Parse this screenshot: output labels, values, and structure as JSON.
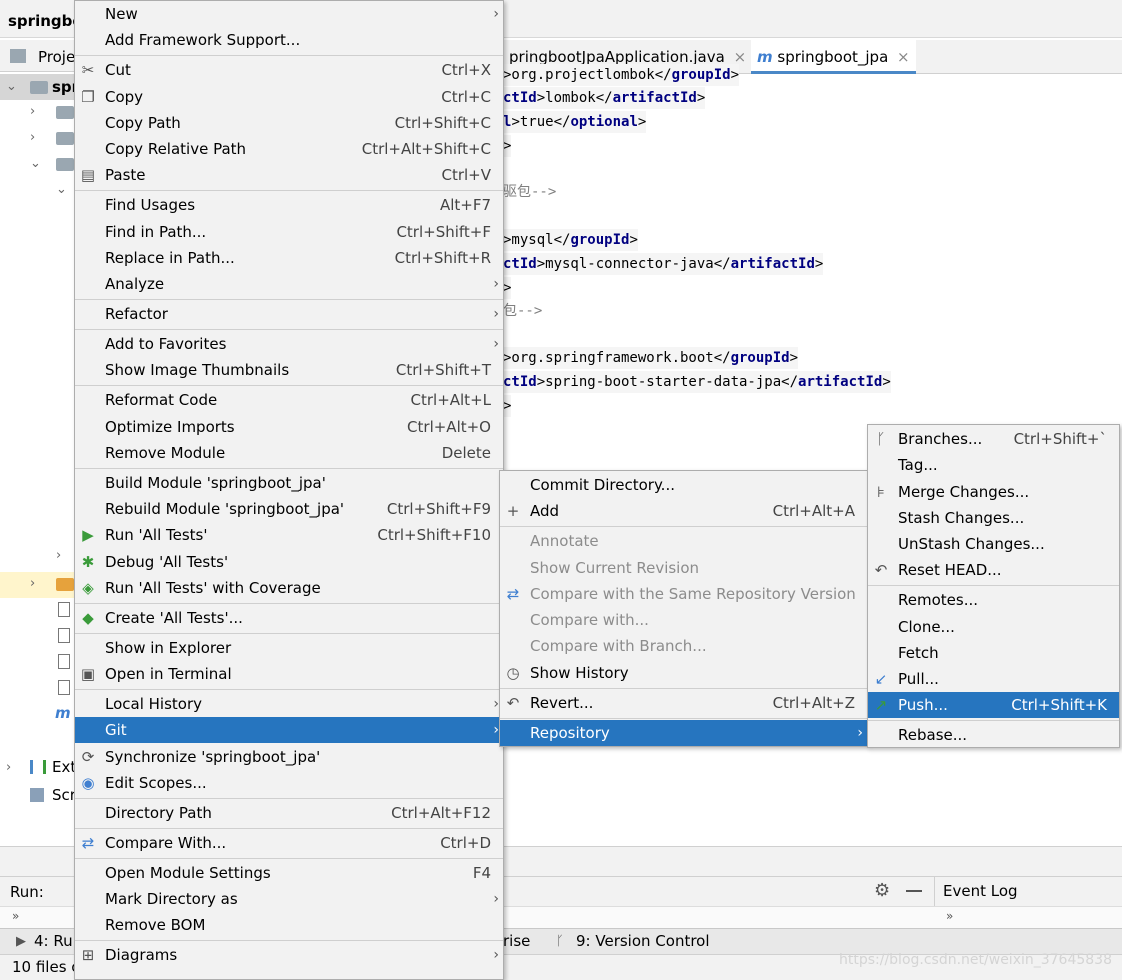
{
  "ide": {
    "project_name": "springbo",
    "project_tab": "Proje",
    "project_root": "spr",
    "editor_tabs": [
      {
        "label": "pringbootJpaApplication.java",
        "active": false,
        "icon": "java-icon"
      },
      {
        "label": "springboot_jpa",
        "active": true,
        "icon": "maven-icon"
      }
    ],
    "tab_close": "×",
    "tree_items": {
      "external_libraries": "Ext",
      "scratches": "Scr"
    },
    "code_lines": [
      {
        "pre": "",
        "tag": "",
        "text": ">org.projectlombok</",
        "tag2": "groupId",
        "post": ">"
      },
      {
        "pre": "",
        "tag": "ctId",
        "text": ">lombok</",
        "tag2": "artifactId",
        "post": ">"
      },
      {
        "pre": "",
        "tag": "l",
        "text": ">true</",
        "tag2": "optional",
        "post": ">"
      },
      {
        "pre": "",
        "tag": "",
        "text": ">",
        "tag2": "",
        "post": ""
      },
      {
        "pre": "",
        "tag": "",
        "text": "",
        "tag2": "",
        "post": ""
      },
      {
        "comment": "驱包-->"
      },
      {
        "pre": "",
        "tag": "",
        "text": "",
        "tag2": "",
        "post": ""
      },
      {
        "pre": "",
        "tag": "",
        "text": ">mysql</",
        "tag2": "groupId",
        "post": ">"
      },
      {
        "pre": "",
        "tag": "ctId",
        "text": ">mysql-connector-java</",
        "tag2": "artifactId",
        "post": ">"
      },
      {
        "pre": "",
        "tag": "",
        "text": ">",
        "tag2": "",
        "post": ""
      },
      {
        "comment": "包-->"
      },
      {
        "pre": "",
        "tag": "",
        "text": "",
        "tag2": "",
        "post": ""
      },
      {
        "pre": "",
        "tag": "",
        "text": ">org.springframework.boot</",
        "tag2": "groupId",
        "post": ">"
      },
      {
        "pre": "",
        "tag": "ctId",
        "text": ">spring-boot-starter-data-jpa</",
        "tag2": "artifactId",
        "post": ">"
      },
      {
        "pre": "",
        "tag": "",
        "text": ">",
        "tag2": "",
        "post": ""
      }
    ],
    "run_label": "Run:",
    "event_log": "Event Log",
    "status_run": "4: Ru",
    "status_prise": "rise",
    "status_vc": "9: Version Control",
    "status_files": "10 files c",
    "watermark": "https://blog.csdn.net/weixin_37645838"
  },
  "main_menu": {
    "items": [
      {
        "label": "New",
        "shortcut": "",
        "submenu": true,
        "icon": ""
      },
      {
        "label": "Add Framework Support...",
        "shortcut": "",
        "submenu": false,
        "icon": ""
      },
      {
        "label": "Cut",
        "shortcut": "Ctrl+X",
        "submenu": false,
        "icon": "scissors-icon",
        "glyph": "✂"
      },
      {
        "label": "Copy",
        "shortcut": "Ctrl+C",
        "submenu": false,
        "icon": "copy-icon",
        "glyph": "❐"
      },
      {
        "label": "Copy Path",
        "shortcut": "Ctrl+Shift+C",
        "submenu": false,
        "icon": ""
      },
      {
        "label": "Copy Relative Path",
        "shortcut": "Ctrl+Alt+Shift+C",
        "submenu": false,
        "icon": ""
      },
      {
        "label": "Paste",
        "shortcut": "Ctrl+V",
        "submenu": false,
        "icon": "paste-icon",
        "glyph": "▤"
      },
      {
        "label": "Find Usages",
        "shortcut": "Alt+F7",
        "submenu": false,
        "icon": ""
      },
      {
        "label": "Find in Path...",
        "shortcut": "Ctrl+Shift+F",
        "submenu": false,
        "icon": ""
      },
      {
        "label": "Replace in Path...",
        "shortcut": "Ctrl+Shift+R",
        "submenu": false,
        "icon": ""
      },
      {
        "label": "Analyze",
        "shortcut": "",
        "submenu": true,
        "icon": ""
      },
      {
        "label": "Refactor",
        "shortcut": "",
        "submenu": true,
        "icon": ""
      },
      {
        "label": "Add to Favorites",
        "shortcut": "",
        "submenu": true,
        "icon": ""
      },
      {
        "label": "Show Image Thumbnails",
        "shortcut": "Ctrl+Shift+T",
        "submenu": false,
        "icon": ""
      },
      {
        "label": "Reformat Code",
        "shortcut": "Ctrl+Alt+L",
        "submenu": false,
        "icon": ""
      },
      {
        "label": "Optimize Imports",
        "shortcut": "Ctrl+Alt+O",
        "submenu": false,
        "icon": ""
      },
      {
        "label": "Remove Module",
        "shortcut": "Delete",
        "submenu": false,
        "icon": ""
      },
      {
        "label": "Build Module 'springboot_jpa'",
        "shortcut": "",
        "submenu": false,
        "icon": ""
      },
      {
        "label": "Rebuild Module 'springboot_jpa'",
        "shortcut": "Ctrl+Shift+F9",
        "submenu": false,
        "icon": ""
      },
      {
        "label": "Run 'All Tests'",
        "shortcut": "Ctrl+Shift+F10",
        "submenu": false,
        "icon": "run-icon",
        "glyph": "▶"
      },
      {
        "label": "Debug 'All Tests'",
        "shortcut": "",
        "submenu": false,
        "icon": "debug-icon",
        "glyph": "✱"
      },
      {
        "label": "Run 'All Tests' with Coverage",
        "shortcut": "",
        "submenu": false,
        "icon": "coverage-icon",
        "glyph": "◈"
      },
      {
        "label": "Create 'All Tests'...",
        "shortcut": "",
        "submenu": false,
        "icon": "create-test-icon",
        "glyph": "◆"
      },
      {
        "label": "Show in Explorer",
        "shortcut": "",
        "submenu": false,
        "icon": ""
      },
      {
        "label": "Open in Terminal",
        "shortcut": "",
        "submenu": false,
        "icon": "terminal-icon",
        "glyph": "▣"
      },
      {
        "label": "Local History",
        "shortcut": "",
        "submenu": true,
        "icon": ""
      },
      {
        "label": "Git",
        "shortcut": "",
        "submenu": true,
        "icon": "",
        "selected": true
      },
      {
        "label": "Synchronize 'springboot_jpa'",
        "shortcut": "",
        "submenu": false,
        "icon": "sync-icon",
        "glyph": "⟳"
      },
      {
        "label": "Edit Scopes...",
        "shortcut": "",
        "submenu": false,
        "icon": "scope-icon",
        "glyph": "◉"
      },
      {
        "label": "Directory Path",
        "shortcut": "Ctrl+Alt+F12",
        "submenu": false,
        "icon": ""
      },
      {
        "label": "Compare With...",
        "shortcut": "Ctrl+D",
        "submenu": false,
        "icon": "compare-icon",
        "glyph": "⇄"
      },
      {
        "label": "Open Module Settings",
        "shortcut": "F4",
        "submenu": false,
        "icon": ""
      },
      {
        "label": "Mark Directory as",
        "shortcut": "",
        "submenu": true,
        "icon": ""
      },
      {
        "label": "Remove BOM",
        "shortcut": "",
        "submenu": false,
        "icon": ""
      },
      {
        "label": "Diagrams",
        "shortcut": "",
        "submenu": true,
        "icon": "diagram-icon",
        "glyph": "⊞"
      }
    ]
  },
  "git_menu": {
    "items": [
      {
        "label": "Commit Directory...",
        "shortcut": "",
        "submenu": false,
        "icon": "",
        "disabled": false
      },
      {
        "label": "Add",
        "shortcut": "Ctrl+Alt+A",
        "submenu": false,
        "icon": "add-icon",
        "glyph": "+",
        "disabled": false
      },
      {
        "label": "Annotate",
        "shortcut": "",
        "submenu": false,
        "icon": "",
        "disabled": true
      },
      {
        "label": "Show Current Revision",
        "shortcut": "",
        "submenu": false,
        "icon": "",
        "disabled": true
      },
      {
        "label": "Compare with the Same Repository Version",
        "shortcut": "",
        "submenu": false,
        "icon": "compare-icon",
        "glyph": "⇄",
        "disabled": true
      },
      {
        "label": "Compare with...",
        "shortcut": "",
        "submenu": false,
        "icon": "",
        "disabled": true
      },
      {
        "label": "Compare with Branch...",
        "shortcut": "",
        "submenu": false,
        "icon": "",
        "disabled": true
      },
      {
        "label": "Show History",
        "shortcut": "",
        "submenu": false,
        "icon": "history-icon",
        "glyph": "◷",
        "disabled": false
      },
      {
        "label": "Revert...",
        "shortcut": "Ctrl+Alt+Z",
        "submenu": false,
        "icon": "revert-icon",
        "glyph": "↶",
        "disabled": false
      },
      {
        "label": "Repository",
        "shortcut": "",
        "submenu": true,
        "icon": "",
        "disabled": false,
        "selected": true
      }
    ]
  },
  "repo_menu": {
    "items": [
      {
        "label": "Branches...",
        "shortcut": "Ctrl+Shift+`",
        "icon": "branch-icon",
        "glyph": "ᚴ"
      },
      {
        "label": "Tag...",
        "shortcut": "",
        "icon": ""
      },
      {
        "label": "Merge Changes...",
        "shortcut": "",
        "icon": "merge-icon",
        "glyph": "⊧"
      },
      {
        "label": "Stash Changes...",
        "shortcut": "",
        "icon": ""
      },
      {
        "label": "UnStash Changes...",
        "shortcut": "",
        "icon": ""
      },
      {
        "label": "Reset HEAD...",
        "shortcut": "",
        "icon": "reset-icon",
        "glyph": "↶"
      },
      {
        "label": "Remotes...",
        "shortcut": "",
        "icon": ""
      },
      {
        "label": "Clone...",
        "shortcut": "",
        "icon": ""
      },
      {
        "label": "Fetch",
        "shortcut": "",
        "icon": ""
      },
      {
        "label": "Pull...",
        "shortcut": "",
        "icon": "pull-icon",
        "glyph": "↙"
      },
      {
        "label": "Push...",
        "shortcut": "Ctrl+Shift+K",
        "icon": "push-icon",
        "glyph": "↗",
        "selected": true
      },
      {
        "label": "Rebase...",
        "shortcut": "",
        "icon": ""
      }
    ]
  }
}
